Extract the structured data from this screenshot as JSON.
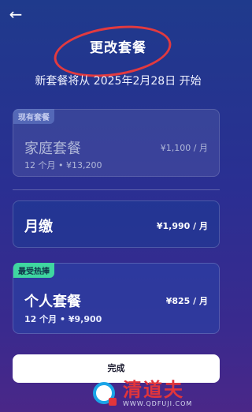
{
  "nav": {
    "back_icon": "←"
  },
  "header": {
    "title": "更改套餐",
    "subtitle": "新套餐将从 2025年2月28日 开始"
  },
  "current_plan": {
    "badge": "现有套餐",
    "name": "家庭套餐",
    "detail": "12 个月 • ¥13,200",
    "price": "¥1,100 / 月"
  },
  "monthly_plan": {
    "name": "月缴",
    "price": "¥1,990 / 月"
  },
  "personal_plan": {
    "badge": "最受热捧",
    "name": "个人套餐",
    "detail": "12 个月 • ¥9,900",
    "price": "¥825 / 月"
  },
  "actions": {
    "done_label": "完成"
  },
  "watermark": {
    "name": "清道夫",
    "url": "WWW.QDFUJI.COM"
  },
  "colors": {
    "annotation_red": "#e23a3f",
    "badge_hot": "#3fd6a0",
    "watermark_red": "#e2353b",
    "watermark_blue": "#1aa5e8"
  }
}
